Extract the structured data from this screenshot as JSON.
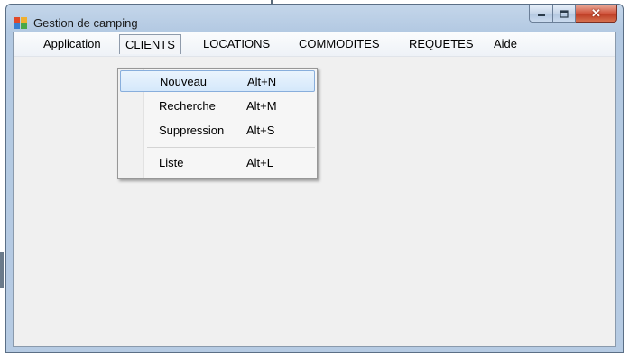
{
  "window": {
    "title": "Gestion de camping",
    "close_glyph": "✕"
  },
  "menubar": {
    "items": [
      {
        "label": "Application"
      },
      {
        "label": "CLIENTS"
      },
      {
        "label": "LOCATIONS"
      },
      {
        "label": "COMMODITES"
      },
      {
        "label": "REQUETES"
      },
      {
        "label": "Aide"
      }
    ]
  },
  "clients_menu": {
    "items": [
      {
        "label": "Nouveau",
        "shortcut": "Alt+N"
      },
      {
        "label": "Recherche",
        "shortcut": "Alt+M"
      },
      {
        "label": "Suppression",
        "shortcut": "Alt+S"
      },
      {
        "label": "Liste",
        "shortcut": "Alt+L"
      }
    ]
  },
  "icons": {
    "app": "app-grid-icon",
    "minimize": "minimize-icon",
    "maximize": "maximize-icon",
    "close": "close-icon"
  },
  "colors": {
    "titlebar": "#b6cbe3",
    "close_button": "#c9472e",
    "menu_highlight": "#d5e8fb",
    "client_background": "#f0f0f0"
  }
}
